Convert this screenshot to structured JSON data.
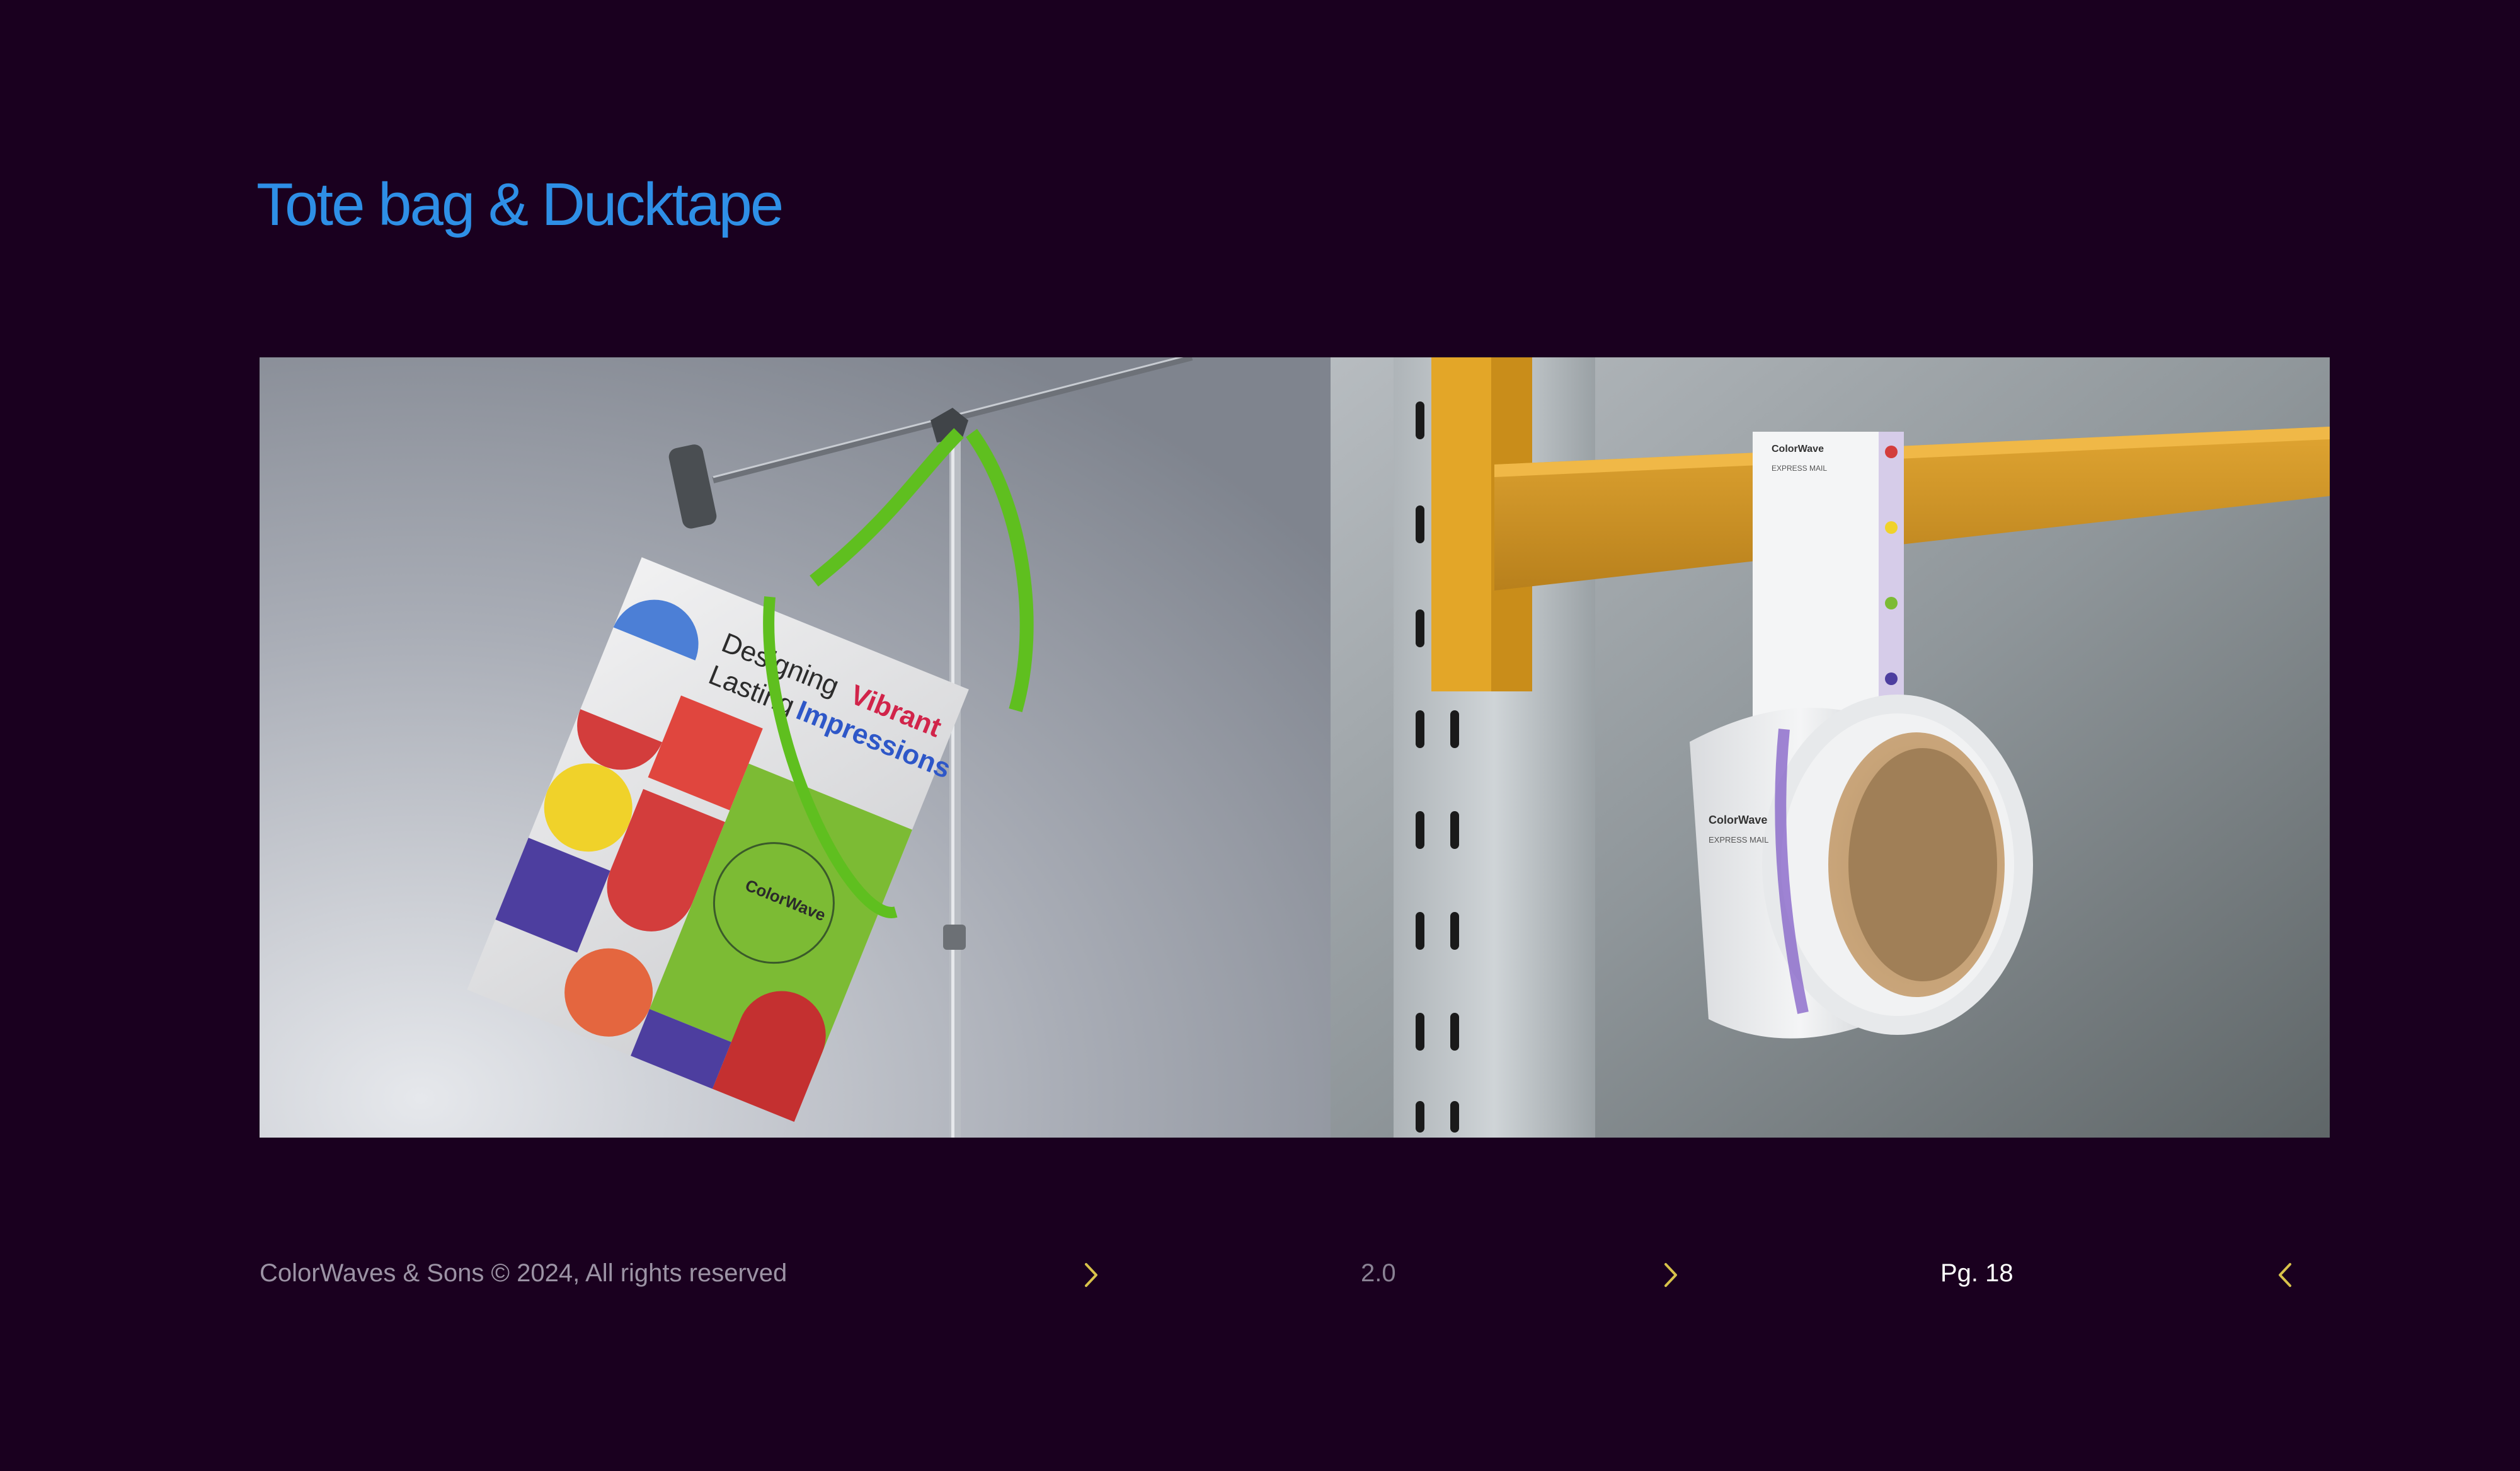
{
  "page": {
    "title": "Tote bag & Ducktape",
    "background": "#1a001f",
    "accent": "#2e8fe6"
  },
  "photo": {
    "tote_bag": {
      "print_lines": [
        "Designing",
        "Vibrant",
        "Lasting",
        "Impressions"
      ],
      "brand": "ColorWave"
    },
    "tape": {
      "brand": "ColorWave",
      "label": "EXPRESS MAIL"
    }
  },
  "footer": {
    "copyright": "ColorWaves & Sons © 2024, All rights reserved",
    "version": "2.0",
    "page": "Pg. 18",
    "chevron_color": "#d8c24a",
    "icons": [
      "chevron-right-icon",
      "chevron-right-icon",
      "chevron-left-icon"
    ]
  }
}
